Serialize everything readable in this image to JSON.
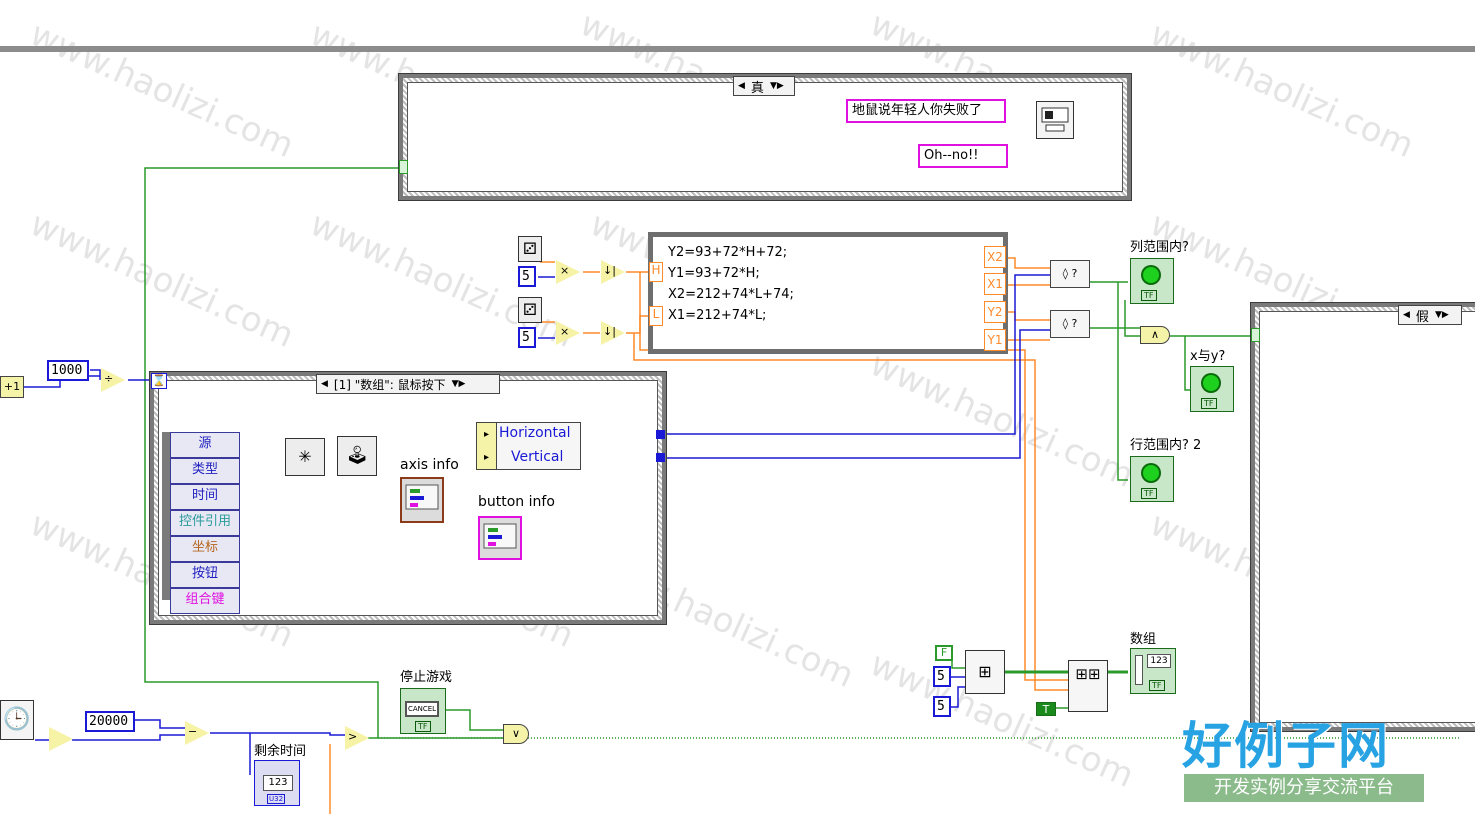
{
  "case_top": {
    "selector_label": "真"
  },
  "case_right": {
    "selector_label": "假"
  },
  "event_struct": {
    "selector_label": "[1] \"数组\": 鼠标按下"
  },
  "strings": {
    "msg1": "地鼠说年轻人你失败了",
    "msg2": "Oh--no!!"
  },
  "constants": {
    "c_1000": "1000",
    "c_20000": "20000",
    "c_5a": "5",
    "c_5b": "5",
    "c_5c": "5",
    "c_5d": "5",
    "bool_f": "F",
    "bool_t": "T",
    "plus_one": "+1"
  },
  "formula": {
    "lines": [
      "Y2=93+72*H+72;",
      "Y1=93+72*H;",
      "X2=212+74*L+74;",
      "X1=212+74*L;"
    ],
    "inputs": [
      "H",
      "L"
    ],
    "outputs": [
      "X2",
      "X1",
      "Y2",
      "Y1"
    ]
  },
  "event_data": [
    "源",
    "类型",
    "时间",
    "控件引用",
    "坐标",
    "按钮",
    "组合键"
  ],
  "bundle": [
    "Horizontal",
    "Vertical"
  ],
  "labels": {
    "axis_info": "axis info",
    "button_info": "button info",
    "col_in_range": "列范围内?",
    "row_in_range": "行范围内?  2",
    "x_and_y": "x与y?",
    "array": "数组",
    "remaining_time": "剩余时间",
    "stop_game": "停止游戏"
  },
  "indicator_text": {
    "tf": "TF",
    "cancel": "CANCEL",
    "u32": "U32",
    "num": "123"
  },
  "watermark": {
    "text": "www.haolizi.com",
    "brand_main": "好例子网",
    "brand_sub": "开发实例分享交流平台"
  }
}
